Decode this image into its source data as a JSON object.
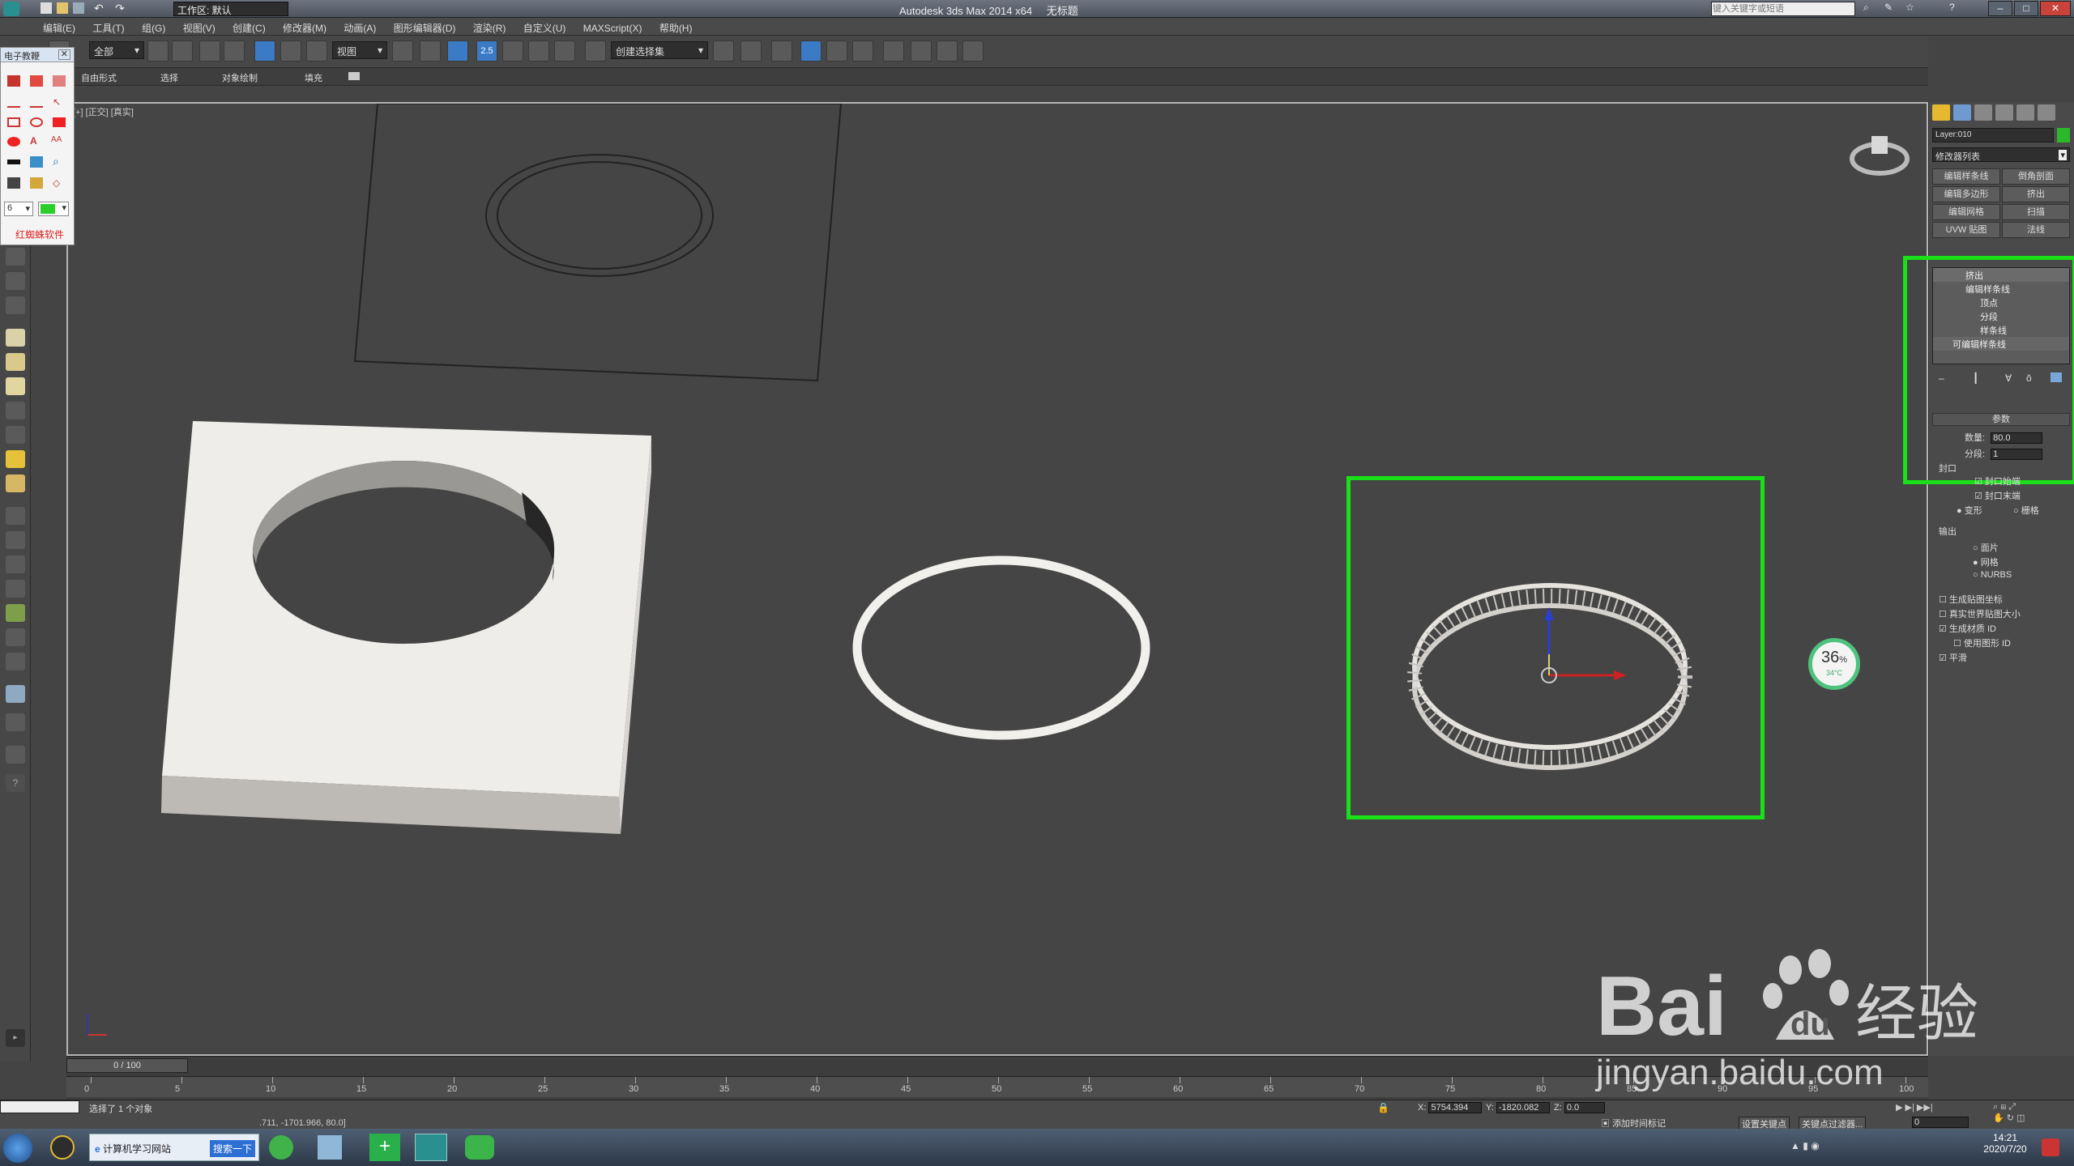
{
  "title_bar": {
    "workspace": "工作区: 默认",
    "app_title": "Autodesk 3ds Max  2014 x64",
    "file_name": "无标题",
    "search_placeholder": "键入关键字或短语"
  },
  "menu": [
    "编辑(E)",
    "工具(T)",
    "组(G)",
    "视图(V)",
    "创建(C)",
    "修改器(M)",
    "动画(A)",
    "图形编辑器(D)",
    "渲染(R)",
    "自定义(U)",
    "MAXScript(X)",
    "帮助(H)"
  ],
  "toolbar": {
    "filter_select": "全部",
    "ref_coord": "视图",
    "named_selection": "创建选择集",
    "snap_value": "2.5"
  },
  "ribbon": [
    "自由形式",
    "选择",
    "对象绘制",
    "填充"
  ],
  "draw_panel": {
    "title": "电子教鞭",
    "width_value": "6",
    "brand": "红蜘蛛软件"
  },
  "viewport": {
    "label": "[+] [正交] [真实]"
  },
  "command_panel": {
    "object_name": "Layer:010",
    "modifier_list": "修改器列表",
    "modifier_buttons": [
      "编辑样条线",
      "倒角剖面",
      "编辑多边形",
      "挤出",
      "编辑网格",
      "扫描",
      "UVW 贴图",
      "法线"
    ],
    "stack": [
      "挤出",
      "编辑样条线",
      "顶点",
      "分段",
      "样条线",
      "可编辑样条线"
    ],
    "params_title": "参数",
    "amount_label": "数量:",
    "amount_value": "80.0",
    "segments_label": "分段:",
    "segments_value": "1",
    "cap_title": "封口",
    "cap_start": "封口始端",
    "cap_end": "封口末端",
    "morph": "变形",
    "grid": "栅格",
    "output_title": "输出",
    "output_options": [
      "面片",
      "网格",
      "NURBS"
    ],
    "gen_map_coords": "生成贴图坐标",
    "real_world": "真实世界贴图大小",
    "gen_mat_ids": "生成材质 ID",
    "use_shape_ids": "使用图形 ID",
    "smooth": "平滑"
  },
  "perf_widget": {
    "percent": "36",
    "percent_sign": "%",
    "temp": "34°C"
  },
  "timeline": {
    "frame_counter": "0 / 100",
    "ticks": [
      "0",
      "5",
      "10",
      "15",
      "20",
      "25",
      "30",
      "35",
      "40",
      "45",
      "50",
      "55",
      "60",
      "65",
      "70",
      "75",
      "80",
      "85",
      "90",
      "95",
      "100"
    ]
  },
  "status": {
    "selection": "选择了 1 个对象",
    "coord_text": ".711, -1701.966, 80.0]",
    "x_label": "X:",
    "x_value": "5754.394",
    "y_label": "Y:",
    "y_value": "-1820.082",
    "z_label": "Z:",
    "z_value": "0.0",
    "add_time_tag": "添加时间标记",
    "set_key": "设置关键点",
    "key_filters": "关键点过滤器...",
    "frame_value": "0"
  },
  "taskbar": {
    "ie_tab": "计算机学习网站",
    "search_btn": "搜索一下",
    "time": "14:21",
    "date": "2020/7/20"
  },
  "watermark": {
    "text": "jingyan.baidu.com"
  }
}
